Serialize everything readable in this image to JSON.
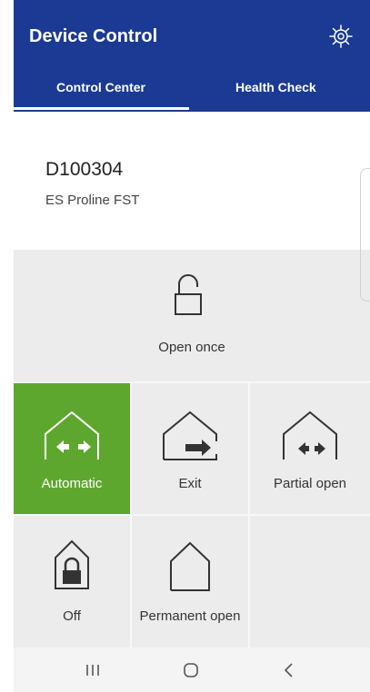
{
  "header": {
    "title": "Device Control",
    "tabs": [
      {
        "label": "Control Center",
        "active": true
      },
      {
        "label": "Health Check",
        "active": false
      }
    ]
  },
  "device": {
    "id": "D100304",
    "model": "ES Proline FST"
  },
  "modes": {
    "open_once": "Open once",
    "automatic": "Automatic",
    "exit": "Exit",
    "partial_open": "Partial open",
    "off": "Off",
    "permanent_open": "Permanent open",
    "selected": "Automatic"
  },
  "colors": {
    "header_bg": "#1b3a93",
    "active_mode": "#5ea72f"
  },
  "icons": {
    "settings": "gear-icon",
    "open_once": "unlocked-padlock-icon",
    "automatic": "house-bidirectional-arrow-icon",
    "exit": "house-exit-arrow-icon",
    "partial_open": "house-bidirectional-arrow-icon",
    "off": "house-lock-icon",
    "permanent_open": "house-outline-icon"
  },
  "navbar": [
    "recent-apps",
    "home",
    "back"
  ]
}
